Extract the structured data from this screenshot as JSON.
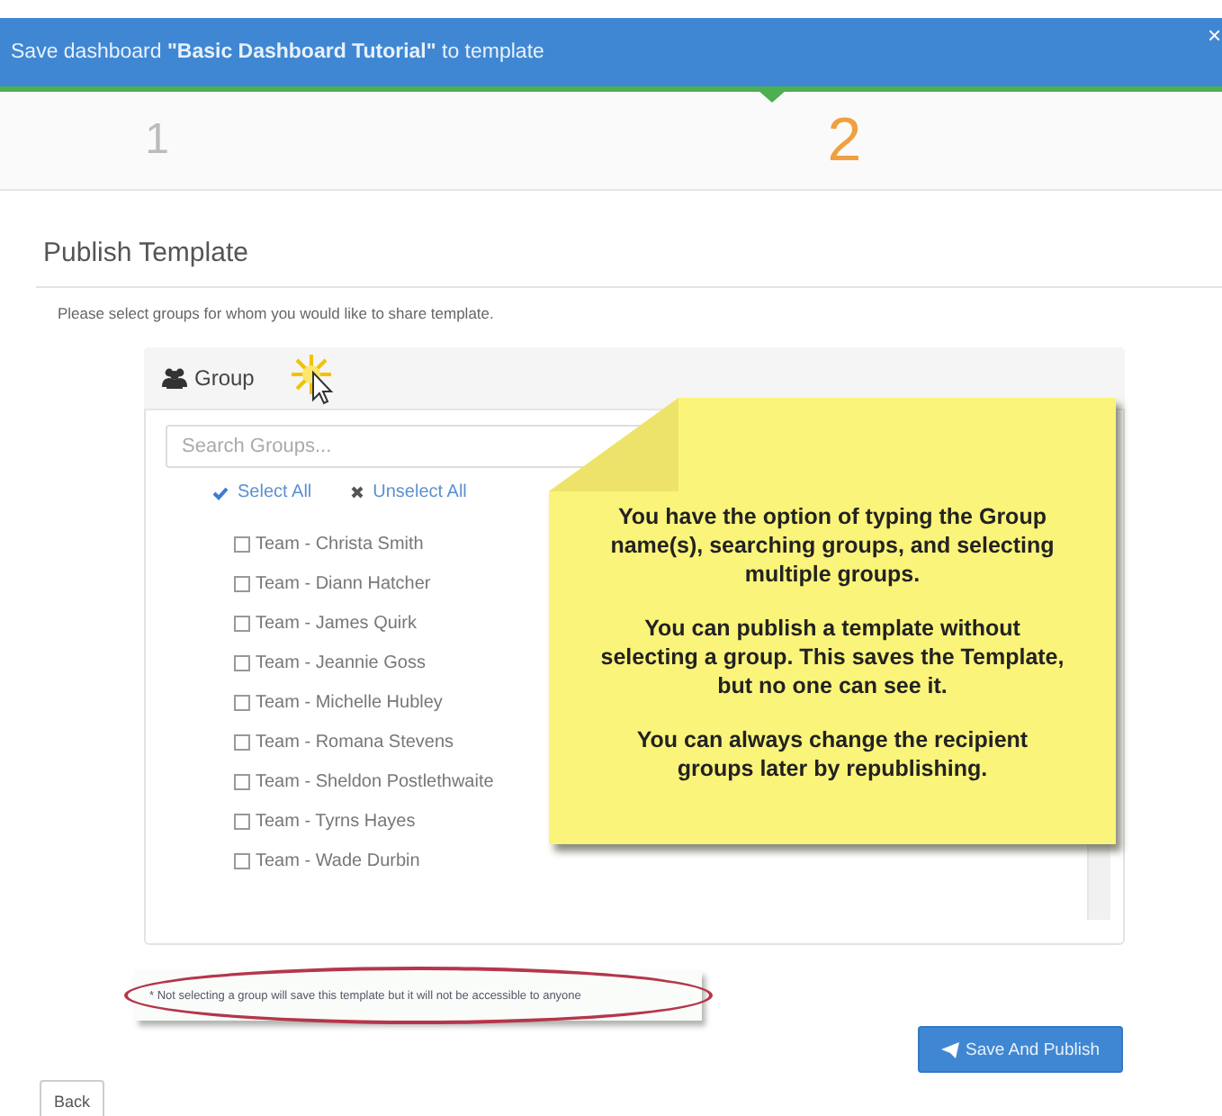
{
  "dialog": {
    "title": "Save dashboard **\"Basic Dashboard Tutorial\"** to template",
    "close": "×"
  },
  "steps": [
    {
      "label": "1",
      "selected": false
    },
    {
      "label": "2",
      "selected": true
    }
  ],
  "section_title": "Publish Template",
  "instruction": "Please select groups for whom you would like to share template.",
  "group_panel": {
    "title": "Group",
    "search": {
      "placeholder": "Search Groups..."
    },
    "select_all": "Select All",
    "unselect_all": "Unselect All",
    "items": [
      {
        "label": "Team - Christa Smith",
        "checked": false
      },
      {
        "label": "Team - Diann Hatcher",
        "checked": false
      },
      {
        "label": "Team - James Quirk",
        "checked": false
      },
      {
        "label": "Team - Jeannie Goss",
        "checked": false
      },
      {
        "label": "Team - Michelle Hubley",
        "checked": false
      },
      {
        "label": "Team - Romana Stevens",
        "checked": false
      },
      {
        "label": "Team - Sheldon Postlethwaite",
        "checked": false
      },
      {
        "label": "Team - Tyrns Hayes",
        "checked": false
      },
      {
        "label": "Team - Wade Durbin",
        "checked": false
      }
    ]
  },
  "callout": {
    "paragraphs": [
      "You have the option of typing the Group name(s), searching groups, and selecting multiple groups.",
      "You can publish a template without selecting a group. This saves the Template, but no one can see it.",
      "You can always change the recipient groups later by republishing."
    ]
  },
  "footnote": "* Not selecting a group will save this template but it will not be accessible to anyone",
  "buttons": {
    "publish": "Save And Publish",
    "back": "Back"
  }
}
